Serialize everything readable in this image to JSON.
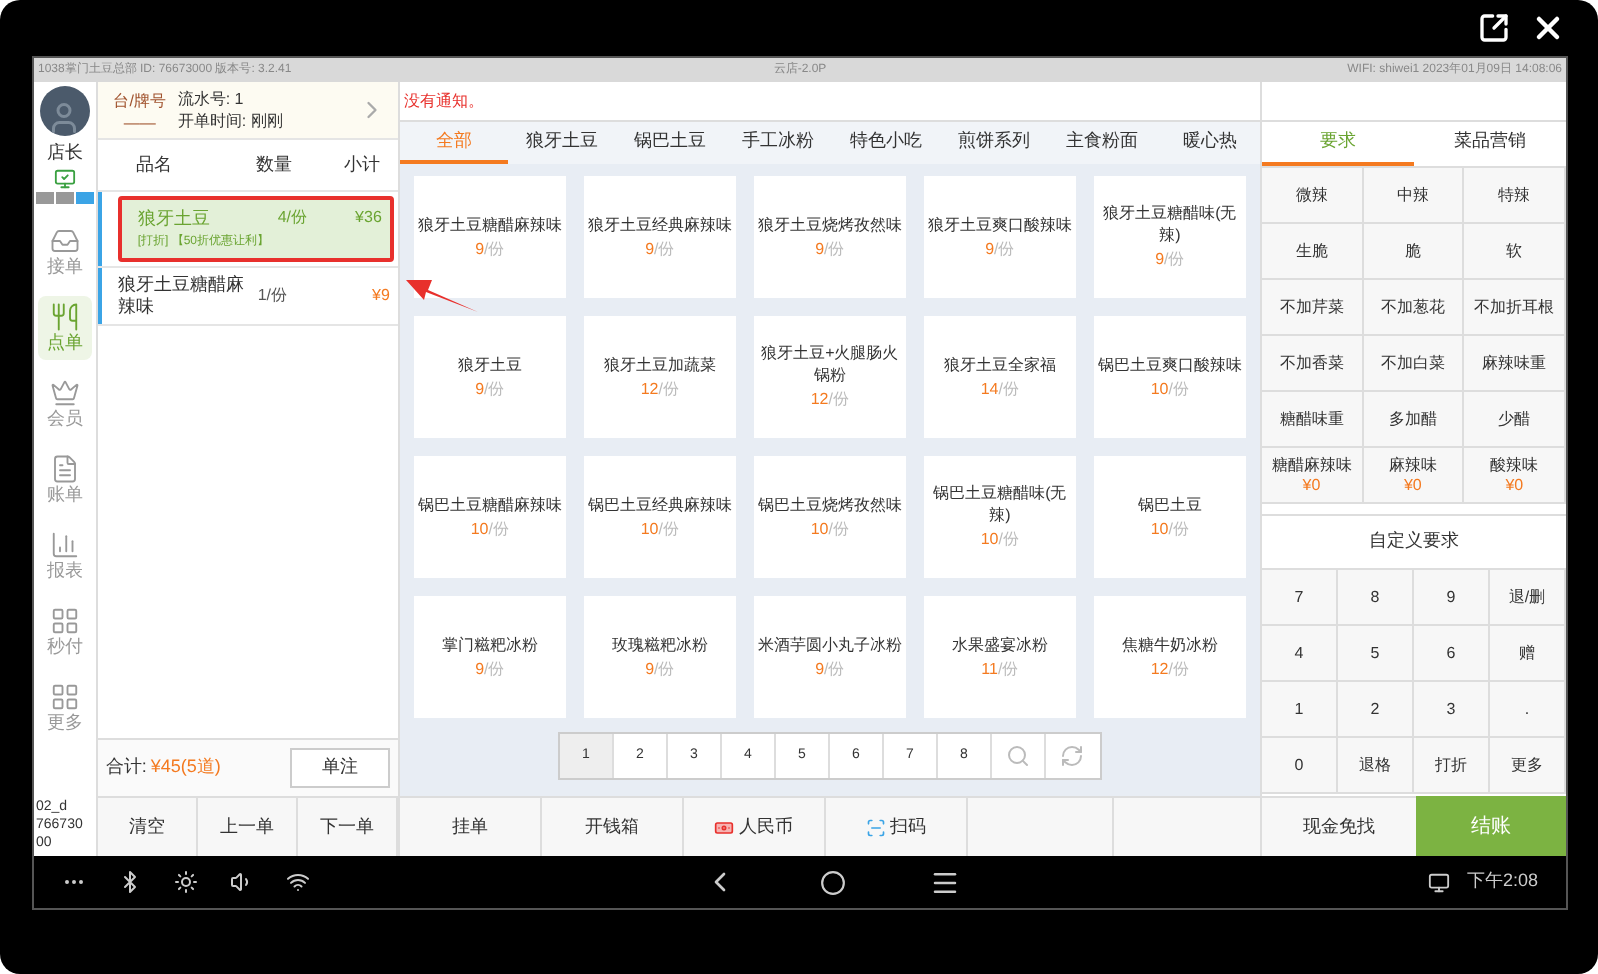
{
  "status_strip": {
    "left": "1038掌门土豆总部 ID: 76673000 版本号: 3.2.41",
    "center": "云店-2.0P",
    "right": "WIFI: shiwei1 2023年01月09日 14:08:06"
  },
  "user": {
    "name": "店长"
  },
  "nav": [
    {
      "label": "接单",
      "selected": false
    },
    {
      "label": "点单",
      "selected": true
    },
    {
      "label": "会员",
      "selected": false
    },
    {
      "label": "账单",
      "selected": false
    },
    {
      "label": "报表",
      "selected": false
    },
    {
      "label": "秒付",
      "selected": false
    },
    {
      "label": "更多",
      "selected": false
    }
  ],
  "device_id": "02_d 76673000",
  "order": {
    "table_label": "台/牌号",
    "table_value": "——",
    "serial": "流水号: 1",
    "open_time": "开单时间: 刚刚",
    "columns": [
      "品名",
      "数量",
      "小计"
    ],
    "rows": [
      {
        "name": "狼牙土豆",
        "qty": "4/份",
        "subtotal": "¥36",
        "note": "[打折] 【50折优惠让利】",
        "selected": true
      },
      {
        "name": "狼牙土豆糖醋麻辣味",
        "qty": "1/份",
        "subtotal": "¥9",
        "selected": false
      }
    ],
    "total_label": "合计:",
    "total_value": "¥45(5道)",
    "note_button": "单注"
  },
  "notification": "没有通知。",
  "categories": [
    {
      "label": "全部",
      "selected": true
    },
    {
      "label": "狼牙土豆",
      "selected": false
    },
    {
      "label": "锅巴土豆",
      "selected": false
    },
    {
      "label": "手工冰粉",
      "selected": false
    },
    {
      "label": "特色小吃",
      "selected": false
    },
    {
      "label": "煎饼系列",
      "selected": false
    },
    {
      "label": "主食粉面",
      "selected": false
    },
    {
      "label": "暖心热",
      "selected": false
    }
  ],
  "products": [
    {
      "name": "狼牙土豆糖醋麻辣味",
      "price": "9",
      "unit": "/份"
    },
    {
      "name": "狼牙土豆经典麻辣味",
      "price": "9",
      "unit": "/份"
    },
    {
      "name": "狼牙土豆烧烤孜然味",
      "price": "9",
      "unit": "/份"
    },
    {
      "name": "狼牙土豆爽口酸辣味",
      "price": "9",
      "unit": "/份"
    },
    {
      "name": "狼牙土豆糖醋味(无辣)",
      "price": "9",
      "unit": "/份"
    },
    {
      "name": "狼牙土豆",
      "price": "9",
      "unit": "/份"
    },
    {
      "name": "狼牙土豆加蔬菜",
      "price": "12",
      "unit": "/份"
    },
    {
      "name": "狼牙土豆+火腿肠火锅粉",
      "price": "12",
      "unit": "/份"
    },
    {
      "name": "狼牙土豆全家福",
      "price": "14",
      "unit": "/份"
    },
    {
      "name": "锅巴土豆爽口酸辣味",
      "price": "10",
      "unit": "/份"
    },
    {
      "name": "锅巴土豆糖醋麻辣味",
      "price": "10",
      "unit": "/份"
    },
    {
      "name": "锅巴土豆经典麻辣味",
      "price": "10",
      "unit": "/份"
    },
    {
      "name": "锅巴土豆烧烤孜然味",
      "price": "10",
      "unit": "/份"
    },
    {
      "name": "锅巴土豆糖醋味(无辣)",
      "price": "10",
      "unit": "/份"
    },
    {
      "name": "锅巴土豆",
      "price": "10",
      "unit": "/份"
    },
    {
      "name": "掌门糍粑冰粉",
      "price": "9",
      "unit": "/份"
    },
    {
      "name": "玫瑰糍粑冰粉",
      "price": "9",
      "unit": "/份"
    },
    {
      "name": "米酒芋圆小丸子冰粉",
      "price": "9",
      "unit": "/份"
    },
    {
      "name": "水果盛宴冰粉",
      "price": "11",
      "unit": "/份"
    },
    {
      "name": "焦糖牛奶冰粉",
      "price": "12",
      "unit": "/份"
    }
  ],
  "pages": [
    {
      "label": "1",
      "selected": true
    },
    {
      "label": "2",
      "selected": false
    },
    {
      "label": "3",
      "selected": false
    },
    {
      "label": "4",
      "selected": false
    },
    {
      "label": "5",
      "selected": false
    },
    {
      "label": "6",
      "selected": false
    },
    {
      "label": "7",
      "selected": false
    },
    {
      "label": "8",
      "selected": false
    }
  ],
  "right_tabs": [
    {
      "label": "要求",
      "selected": true
    },
    {
      "label": "菜品营销",
      "selected": false
    }
  ],
  "requirements": [
    {
      "label": "微辣"
    },
    {
      "label": "中辣"
    },
    {
      "label": "特辣"
    },
    {
      "label": "生脆"
    },
    {
      "label": "脆"
    },
    {
      "label": "软"
    },
    {
      "label": "不加芹菜"
    },
    {
      "label": "不加葱花"
    },
    {
      "label": "不加折耳根"
    },
    {
      "label": "不加香菜"
    },
    {
      "label": "不加白菜"
    },
    {
      "label": "麻辣味重"
    },
    {
      "label": "糖醋味重"
    },
    {
      "label": "多加醋"
    },
    {
      "label": "少醋"
    },
    {
      "label": "糖醋麻辣味",
      "price": "¥0"
    },
    {
      "label": "麻辣味",
      "price": "¥0"
    },
    {
      "label": "酸辣味",
      "price": "¥0"
    }
  ],
  "custom_requirement": "自定义要求",
  "keypad": [
    "7",
    "8",
    "9",
    "退/删",
    "4",
    "5",
    "6",
    "赠",
    "1",
    "2",
    "3",
    ".",
    "0",
    "退格",
    "打折",
    "更多"
  ],
  "bottom_left": [
    "清空",
    "上一单",
    "下一单"
  ],
  "bottom_middle": [
    "挂单",
    "开钱箱",
    "人民币",
    "扫码"
  ],
  "cash_button": "现金免找",
  "checkout_button": "结账",
  "clock": "下午2:08"
}
